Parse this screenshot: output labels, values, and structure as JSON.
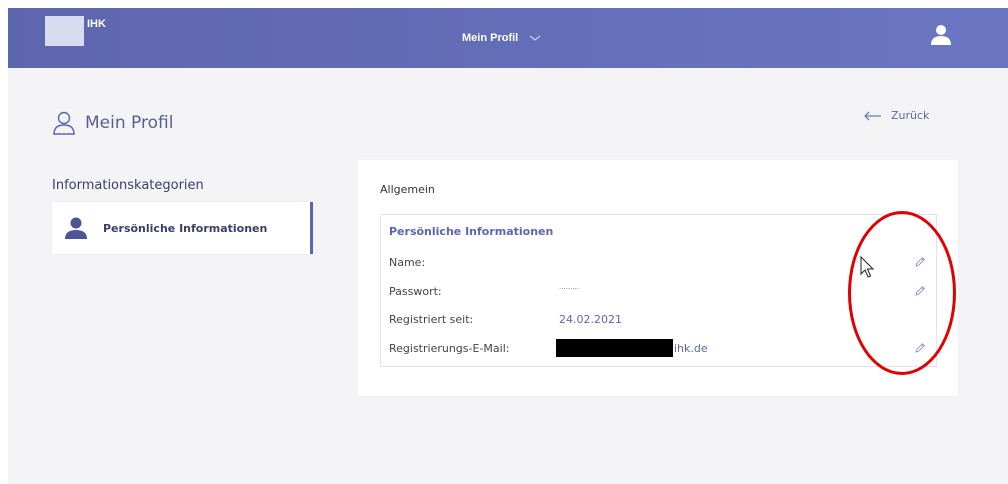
{
  "header": {
    "logo_text": "IHK",
    "menu_label": "Mein Profil"
  },
  "page": {
    "title": "Mein Profil",
    "back_label": "Zurück"
  },
  "sidebar": {
    "title": "Informationskategorien",
    "items": [
      {
        "label": "Persönliche Informationen",
        "active": true
      }
    ]
  },
  "main": {
    "section_title": "Allgemein",
    "info_title": "Persönliche Informationen",
    "rows": [
      {
        "label": "Name:",
        "value": ""
      },
      {
        "label": "Passwort:",
        "value": "·········"
      },
      {
        "label": "Registriert seit:",
        "value": "24.02.2021"
      },
      {
        "label": "Registrierungs-E-Mail:",
        "value": "ihk.de"
      }
    ]
  },
  "colors": {
    "header_start": "#5d66ad",
    "header_end": "#6b76c2",
    "accent": "#5d66ad",
    "annotation": "#e10000"
  },
  "icons": {
    "user": "user-icon",
    "edit": "pencil-icon",
    "back": "arrow-left-icon",
    "menu": "chevron-down-icon"
  }
}
